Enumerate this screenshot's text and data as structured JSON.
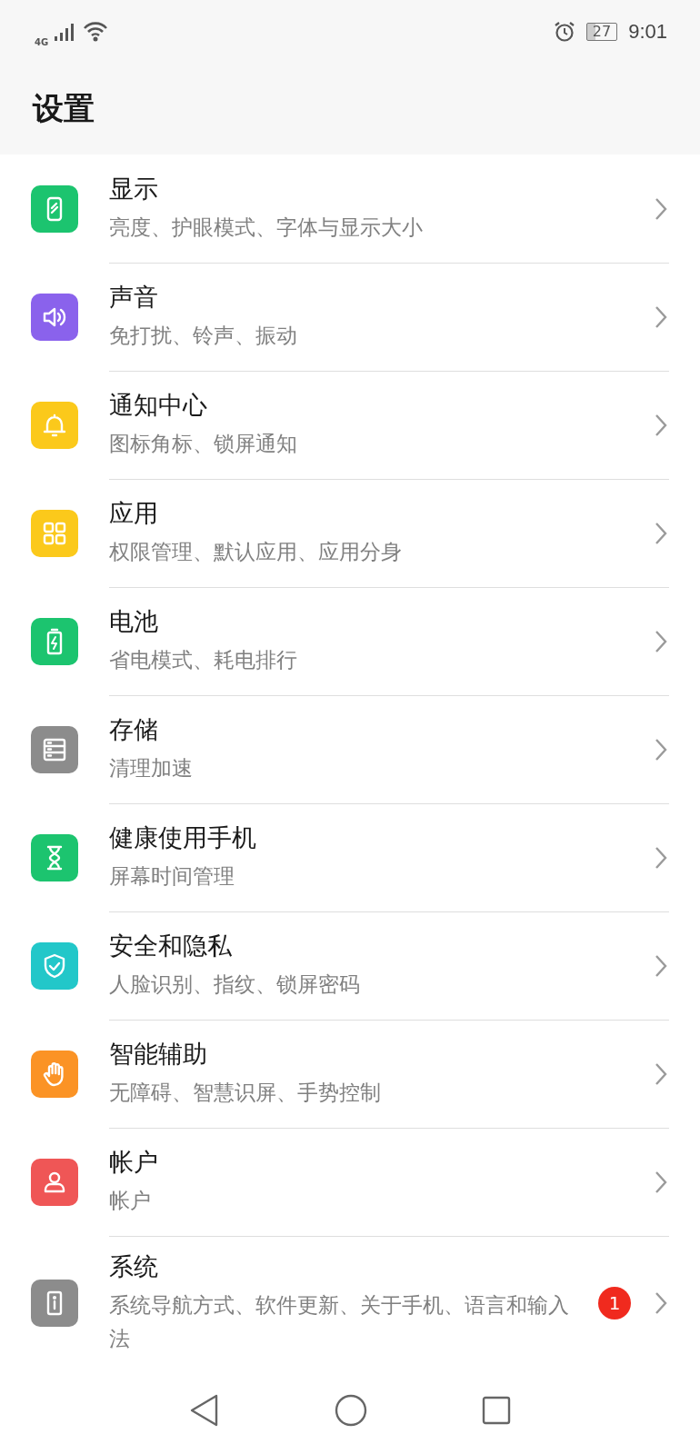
{
  "status_bar": {
    "network": "4G",
    "battery": "27",
    "time": "9:01"
  },
  "title": "设置",
  "items": [
    {
      "kind": "display",
      "color": "#1cc46f",
      "title": "显示",
      "subtitle": "亮度、护眼模式、字体与显示大小"
    },
    {
      "kind": "sound",
      "color": "#8a62ec",
      "title": "声音",
      "subtitle": "免打扰、铃声、振动"
    },
    {
      "kind": "bell",
      "color": "#fbc91b",
      "title": "通知中心",
      "subtitle": "图标角标、锁屏通知"
    },
    {
      "kind": "apps",
      "color": "#fbc91b",
      "title": "应用",
      "subtitle": "权限管理、默认应用、应用分身"
    },
    {
      "kind": "battery",
      "color": "#1cc46f",
      "title": "电池",
      "subtitle": "省电模式、耗电排行"
    },
    {
      "kind": "storage",
      "color": "#8c8c8c",
      "title": "存储",
      "subtitle": "清理加速"
    },
    {
      "kind": "hourglass",
      "color": "#1cc46f",
      "title": "健康使用手机",
      "subtitle": "屏幕时间管理"
    },
    {
      "kind": "shield",
      "color": "#22c7c9",
      "title": "安全和隐私",
      "subtitle": "人脸识别、指纹、锁屏密码"
    },
    {
      "kind": "hand",
      "color": "#fb9325",
      "title": "智能辅助",
      "subtitle": "无障碍、智慧识屏、手势控制"
    },
    {
      "kind": "account",
      "color": "#ef5656",
      "title": "帐户",
      "subtitle": "帐户"
    },
    {
      "kind": "system",
      "color": "#8c8c8c",
      "title": "系统",
      "subtitle": "系统导航方式、软件更新、关于手机、语言和输入法",
      "badge": "1"
    }
  ]
}
